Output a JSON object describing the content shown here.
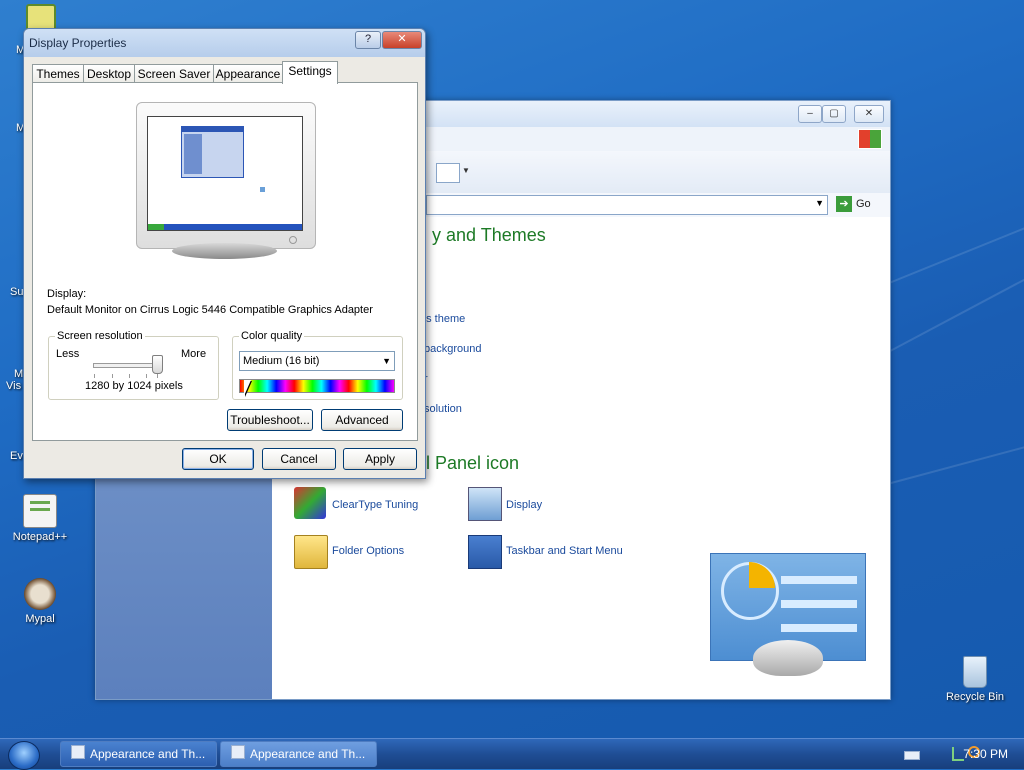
{
  "desktop": {
    "icons": [
      {
        "label": "Notepad++",
        "icon": "notepadpp-icon"
      },
      {
        "label": "Mypal",
        "icon": "mypal-icon"
      },
      {
        "label": "Recycle Bin",
        "icon": "recycle-bin-icon"
      }
    ],
    "partial_labels": [
      "M",
      "C",
      "M",
      "Su",
      "M",
      "Vis",
      "Ev"
    ]
  },
  "control_panel": {
    "address_go": "Go",
    "heading_top": "y and Themes",
    "heading_icons": "ol Panel icon",
    "task_links": [
      "'s theme",
      "background",
      "r",
      "solution"
    ],
    "icon_links": [
      {
        "label": "ClearType Tuning",
        "icon": "cleartype-icon"
      },
      {
        "label": "Display",
        "icon": "display-icon"
      },
      {
        "label": "Folder Options",
        "icon": "folder-options-icon"
      },
      {
        "label": "Taskbar and Start Menu",
        "icon": "taskbar-start-menu-icon"
      }
    ]
  },
  "dialog": {
    "title": "Display Properties",
    "help_btn": "?",
    "close_btn": "✕",
    "tabs": [
      {
        "label": "Themes"
      },
      {
        "label": "Desktop"
      },
      {
        "label": "Screen Saver"
      },
      {
        "label": "Appearance"
      },
      {
        "label": "Settings",
        "active": true
      }
    ],
    "display_label": "Display:",
    "display_value": "Default Monitor on Cirrus Logic 5446 Compatible Graphics Adapter",
    "resolution": {
      "title": "Screen resolution",
      "less": "Less",
      "more": "More",
      "value": "1280 by 1024 pixels",
      "slider_level": 1.0
    },
    "color": {
      "title": "Color quality",
      "selected": "Medium (16 bit)"
    },
    "buttons": {
      "troubleshoot": "Troubleshoot...",
      "advanced": "Advanced",
      "ok": "OK",
      "cancel": "Cancel",
      "apply": "Apply"
    }
  },
  "taskbar": {
    "buttons": [
      {
        "label": "Appearance and Th...",
        "active": false
      },
      {
        "label": "Appearance and Th...",
        "active": true
      }
    ],
    "clock": "7:30 PM"
  },
  "colors": {
    "desktop_blue": "#1f6cc4",
    "cp_heading_green": "#1d7a26",
    "link_blue": "#1a4a9c"
  }
}
